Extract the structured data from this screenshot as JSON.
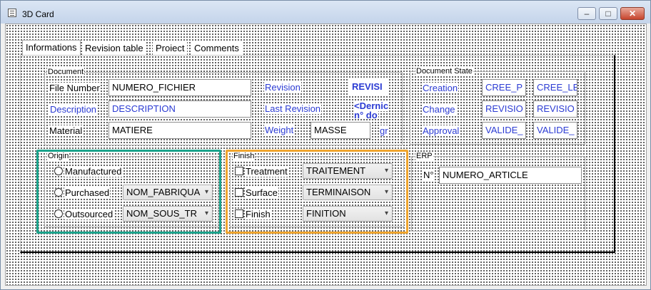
{
  "window": {
    "title": "3D Card",
    "minimize": "–",
    "maximize": "□",
    "close": "✕"
  },
  "tabs": [
    "Informations",
    "Revision table",
    "Proiect",
    "Comments"
  ],
  "document": {
    "group_title": "Document",
    "file_number_label": "File Number",
    "file_number_value": "NUMERO_FICHIER",
    "revision_label": "Revision",
    "revision_value": "REVISI",
    "description_label": "Description",
    "description_value": "DESCRIPTION",
    "last_revision_label": "Last Revision",
    "last_revision_value": "<Dernic",
    "last_revision_value2": "n° do",
    "material_label": "Material",
    "material_value": "MATIERE",
    "weight_label": "Weight",
    "weight_value": "MASSE",
    "weight_unit": "gr"
  },
  "document_state": {
    "group_title": "Document State",
    "creation_label": "Creation",
    "creation_value1": "CREE_P",
    "creation_value2": "CREE_LE",
    "change_label": "Change",
    "change_value1": "REVISIO",
    "change_value2": "REVISIO",
    "approval_label": "Approval",
    "approval_value1": "VALIDE_",
    "approval_value2": "VALIDE_"
  },
  "origin": {
    "group_title": "Origin",
    "manufactured_label": "Manufactured",
    "purchased_label": "Purchased",
    "purchased_value": "NOM_FABRIQUA",
    "outsourced_label": "Outsourced",
    "outsourced_value": "NOM_SOUS_TR"
  },
  "finish": {
    "group_title": "Finish",
    "treatment_label": "Treatment",
    "treatment_value": "TRAITEMENT",
    "surface_label": "Surface",
    "surface_value": "TERMINAISON",
    "finish_label": "Finish",
    "finish_value": "FINITION"
  },
  "erp": {
    "group_title": "ERP",
    "number_label": "N°",
    "number_value": "NUMERO_ARTICLE"
  },
  "colors": {
    "highlight_origin": "#1ba48c",
    "highlight_finish": "#f0a52e",
    "link_blue": "#2b3bd3"
  },
  "icons": {
    "chevron": "▾"
  }
}
